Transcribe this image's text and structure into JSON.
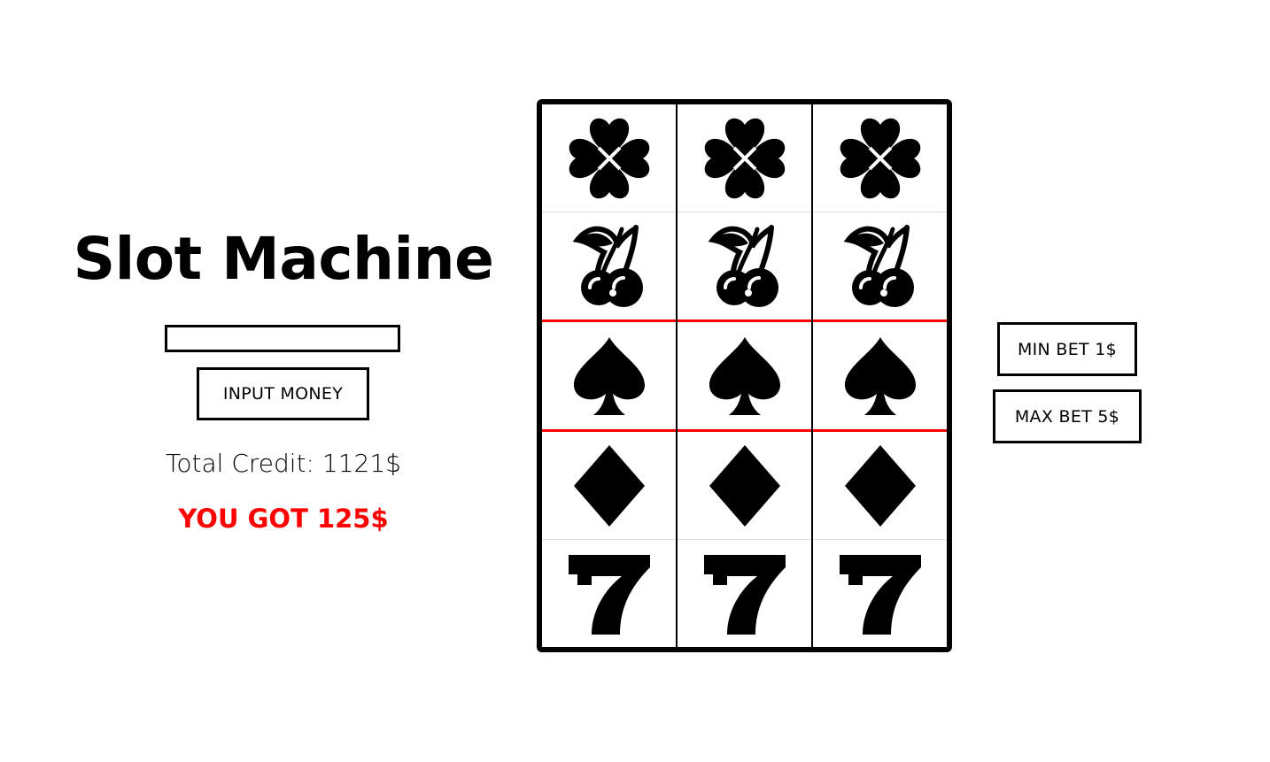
{
  "app": {
    "title": "Slot Machine"
  },
  "money_input": {
    "value": "",
    "placeholder": ""
  },
  "buttons": {
    "input_money": "INPUT MONEY",
    "min_bet": "MIN BET 1$",
    "max_bet": "MAX BET 5$"
  },
  "status": {
    "credit_label": "Total Credit: 1121$",
    "win_message": "YOU GOT 125$"
  },
  "colors": {
    "accent": "#ff0000",
    "border": "#000000",
    "background": "#ffffff"
  },
  "reels": [
    {
      "symbols": [
        "clover-icon",
        "cherry-icon",
        "spade-icon",
        "diamond-icon",
        "seven-icon"
      ]
    },
    {
      "symbols": [
        "clover-icon",
        "cherry-icon",
        "spade-icon",
        "diamond-icon",
        "seven-icon"
      ]
    },
    {
      "symbols": [
        "clover-icon",
        "cherry-icon",
        "spade-icon",
        "diamond-icon",
        "seven-icon"
      ]
    }
  ]
}
